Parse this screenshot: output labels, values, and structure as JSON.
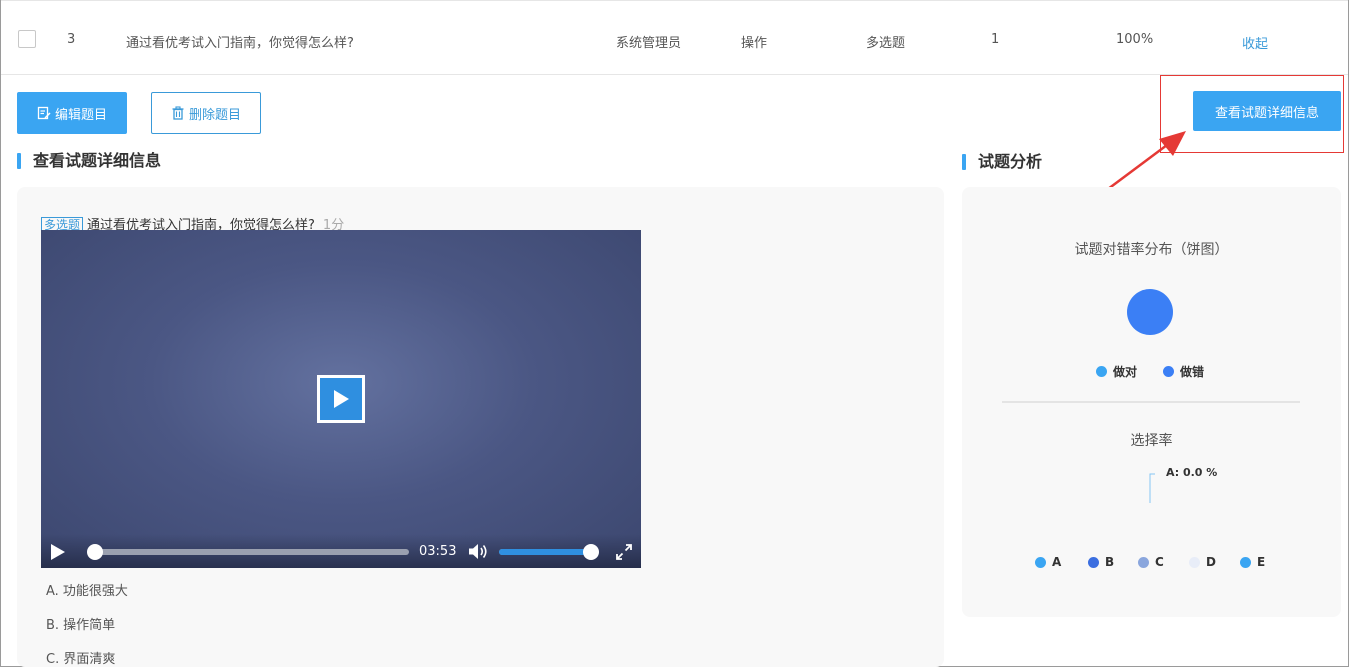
{
  "table_row": {
    "index": "3",
    "question": "通过看优考试入门指南，你觉得怎么样?",
    "creator": "系统管理员",
    "category": "操作",
    "type": "多选题",
    "score": "1",
    "rate": "100%",
    "action": "收起"
  },
  "toolbar": {
    "edit_label": "编辑题目",
    "delete_label": "删除题目",
    "view_detail_label": "查看试题详细信息"
  },
  "detail": {
    "section_title": "查看试题详细信息",
    "question_type": "多选题",
    "question_text": "通过看优考试入门指南，你觉得怎么样?",
    "question_score": "1分",
    "video": {
      "duration": "03:53",
      "progress": 0.0,
      "volume": 1.0
    },
    "options": [
      "A. 功能很强大",
      "B. 操作简单",
      "C. 界面清爽"
    ]
  },
  "analysis": {
    "section_title": "试题分析",
    "pie_title": "试题对错率分布（饼图）",
    "pie_legend": [
      {
        "label": "做对",
        "color": "#3aa5f2"
      },
      {
        "label": "做错",
        "color": "#3b7ff5"
      }
    ],
    "select_title": "选择率",
    "select_label": "A: 0.0 %",
    "select_legend": [
      {
        "label": "A",
        "color": "#3aa5f2"
      },
      {
        "label": "B",
        "color": "#3b6ee0"
      },
      {
        "label": "C",
        "color": "#8aa6dd"
      },
      {
        "label": "D",
        "color": "#e8edf8"
      },
      {
        "label": "E",
        "color": "#3aa5f2"
      }
    ]
  },
  "colors": {
    "primary": "#3aa5f2",
    "link": "#3a9ad9",
    "annotation": "#e53935"
  }
}
